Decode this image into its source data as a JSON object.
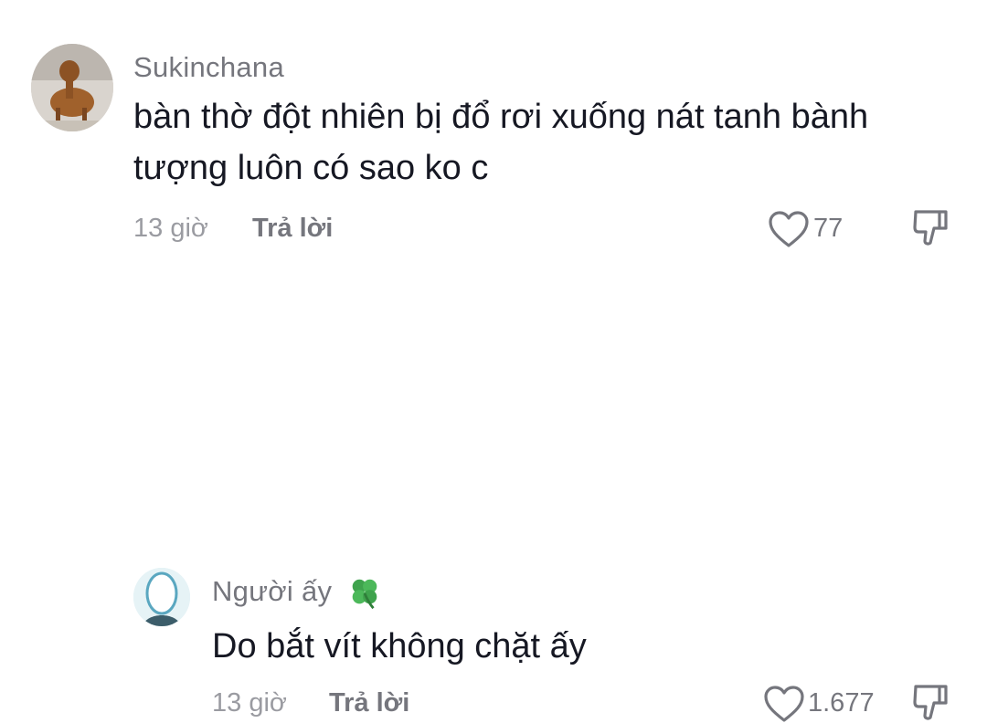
{
  "comments": [
    {
      "username": "Sukinchana",
      "text_line1": "bàn thờ đột nhiên bị đổ rơi xuống nát tanh bành",
      "text_line2": "tượng luôn có sao ko c",
      "time": "13 giờ",
      "reply_label": "Trả lời",
      "likes": "77"
    },
    {
      "username": "Người ấy",
      "text_line1": "Do bắt vít không chặt ấy",
      "time": "13 giờ",
      "reply_label": "Trả lời",
      "likes": "1.677"
    }
  ],
  "icons": {
    "like": "heart-outline-icon",
    "dislike": "thumbs-down-outline-icon",
    "username_emoji": "four-leaf-clover-icon"
  }
}
